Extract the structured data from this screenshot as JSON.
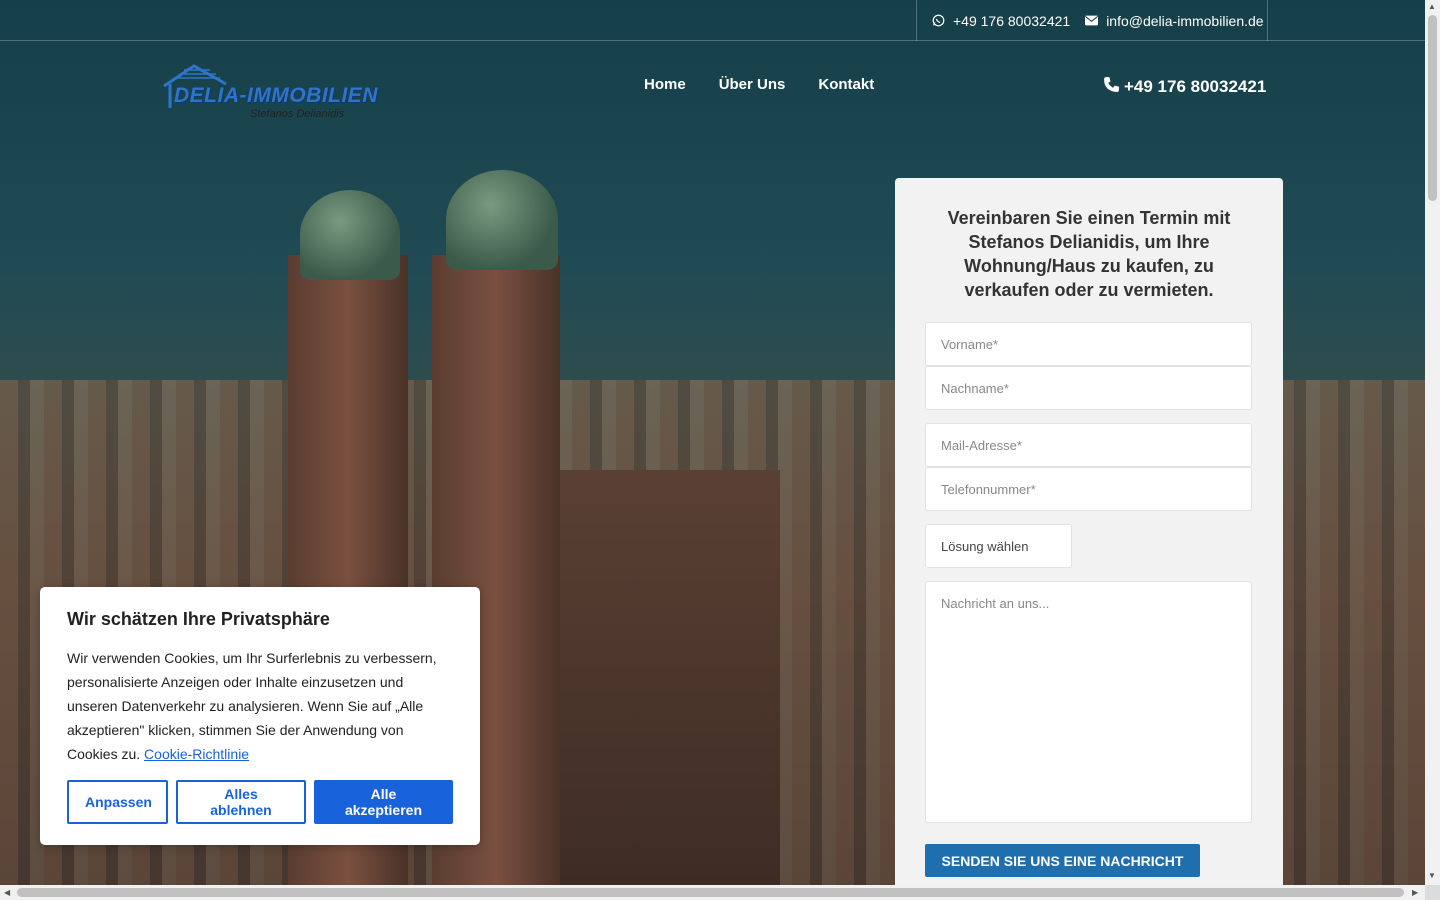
{
  "topbar": {
    "whatsapp": "+49 176 80032421",
    "email": "info@delia-immobilien.de"
  },
  "logo": {
    "text": "DELIA-IMMOBILIEN",
    "sub": "Stefanos Delianidis"
  },
  "nav": {
    "items": [
      "Home",
      "Über Uns",
      "Kontakt"
    ]
  },
  "header": {
    "phone": "+49 176 80032421"
  },
  "form": {
    "title": "Vereinbaren Sie einen Termin mit Stefanos Delianidis, um Ihre Wohnung/Haus zu kaufen, zu verkaufen oder zu vermieten.",
    "firstname_placeholder": "Vorname*",
    "lastname_placeholder": "Nachname*",
    "email_placeholder": "Mail-Adresse*",
    "phone_placeholder": "Telefonnummer*",
    "solution_label": "Lösung wählen",
    "message_placeholder": "Nachricht an uns...",
    "submit_label": "SENDEN SIE UNS EINE NACHRICHT"
  },
  "cookie": {
    "title": "Wir schätzen Ihre Privatsphäre",
    "text": "Wir verwenden Cookies, um Ihr Surferlebnis zu verbessern, personalisierte Anzeigen oder Inhalte einzusetzen und unseren Datenverkehr zu analysieren. Wenn Sie auf „Alle akzeptieren\" klicken, stimmen Sie der Anwendung von Cookies zu.",
    "link": "Cookie-Richtlinie",
    "customize": "Anpassen",
    "reject": "Alles ablehnen",
    "accept": "Alle akzeptieren"
  },
  "colors": {
    "brand": "#2f74c8",
    "submit": "#1f6fae",
    "cookie_accent": "#1863dc"
  }
}
